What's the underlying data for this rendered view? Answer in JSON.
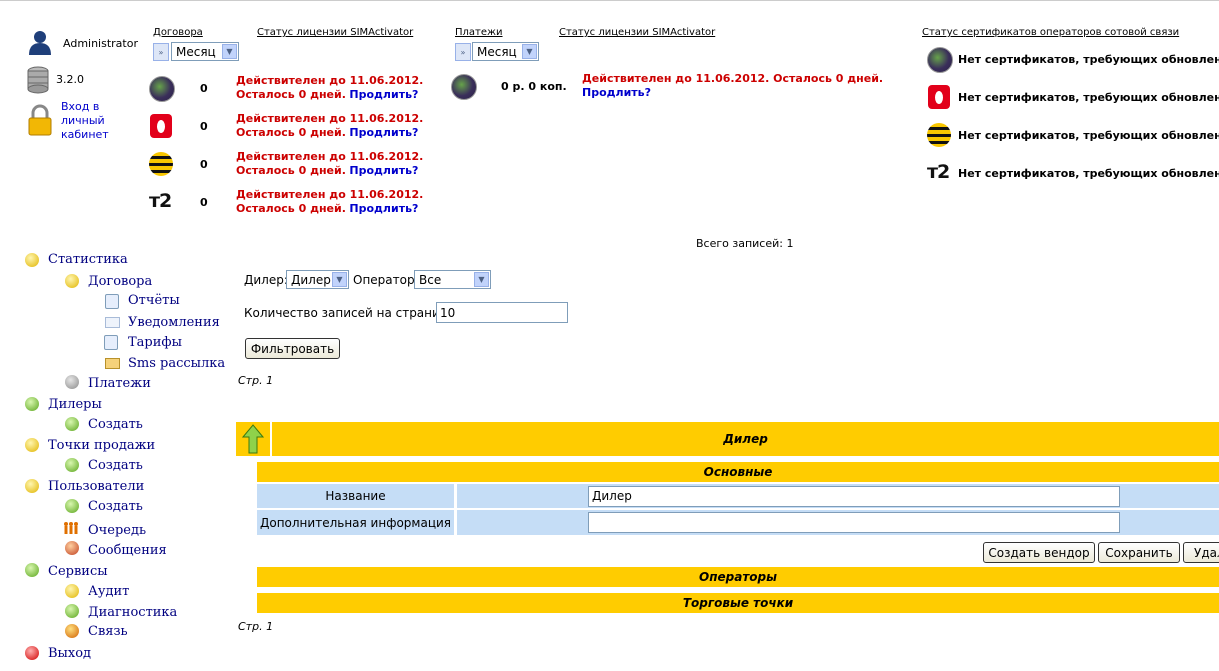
{
  "user": {
    "name": "Administrator",
    "version": "3.2.0",
    "cabinet_link": "Вход в личный кабинет"
  },
  "contracts": {
    "header": "Договора",
    "period": "Месяц"
  },
  "payments": {
    "header": "Платежи",
    "period": "Месяц",
    "amount": "0 р. 0 коп."
  },
  "license_header_1": "Статус лицензии SIMActivator",
  "license_header_2": "Статус лицензии SIMActivator",
  "license": {
    "line1": "Действителен до 11.06.2012.",
    "line2": "Осталось 0 дней.",
    "extend": "Продлить?",
    "payments_line1": "Действителен до 11.06.2012. Осталось 0 дней."
  },
  "operators": [
    {
      "icon": "megafon-icon",
      "count": "0"
    },
    {
      "icon": "mts-icon",
      "count": "0"
    },
    {
      "icon": "beeline-icon",
      "count": "0"
    },
    {
      "icon": "tele2-icon",
      "count": "0"
    }
  ],
  "cert": {
    "header": "Статус сертификатов операторов сотовой связи",
    "items": [
      "Нет сертификатов, требующих обновления",
      "Нет сертификатов, требующих обновления",
      "Нет сертификатов, требующих обновления",
      "Нет сертификатов, требующих обновления"
    ]
  },
  "menu": {
    "statistics": "Статистика",
    "contracts": "Договора",
    "reports": "Отчёты",
    "notifications": "Уведомления",
    "tariffs": "Тарифы",
    "sms": "Sms рассылка",
    "payments": "Платежи",
    "dealers": "Дилеры",
    "dealers_create": "Создать",
    "points": "Точки продажи",
    "points_create": "Создать",
    "users": "Пользователи",
    "users_create": "Создать",
    "queue": "Очередь",
    "messages": "Сообщения",
    "services": "Сервисы",
    "audit": "Аудит",
    "diagnostics": "Диагностика",
    "contact": "Связь",
    "logout": "Выход"
  },
  "filter": {
    "total": "Всего записей: 1",
    "dealer_label": "Дилер:",
    "dealer_value": "Дилер",
    "operator_label": "Оператор:",
    "operator_value": "Все",
    "per_page_label": "Количество записей на страницу:",
    "per_page_value": "10",
    "filter_button": "Фильтровать",
    "page_top": "Стр. 1",
    "page_bottom": "Стр. 1"
  },
  "dealer": {
    "title": "Дилер",
    "section_main": "Основные",
    "name_label": "Название",
    "name_value": "Дилер",
    "info_label": "Дополнительная информация",
    "info_value": "",
    "btn_create_vendor": "Создать вендор",
    "btn_save": "Сохранить",
    "btn_delete": "Удалить",
    "section_operators": "Операторы",
    "section_points": "Торговые точки"
  }
}
